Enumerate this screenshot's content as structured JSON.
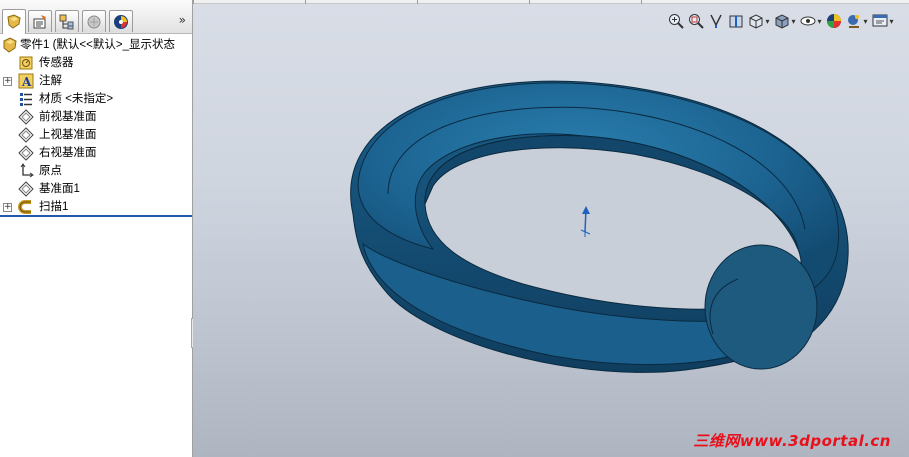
{
  "feature_tree": {
    "root_label": "零件1  (默认<<默认>_显示状态",
    "items": [
      {
        "label": "传感器"
      },
      {
        "label": "注解"
      },
      {
        "label": "材质 <未指定>"
      },
      {
        "label": "前视基准面"
      },
      {
        "label": "上视基准面"
      },
      {
        "label": "右视基准面"
      },
      {
        "label": "原点"
      },
      {
        "label": "基准面1"
      },
      {
        "label": "扫描1"
      }
    ],
    "more_label": "»"
  },
  "panel_tabs": [
    {
      "icon": "feature-manager-icon"
    },
    {
      "icon": "property-manager-icon"
    },
    {
      "icon": "configuration-manager-icon"
    },
    {
      "icon": "dimxpert-icon"
    },
    {
      "icon": "display-manager-icon"
    }
  ],
  "view_toolbar": [
    {
      "icon": "zoom-to-fit-icon"
    },
    {
      "icon": "zoom-to-area-icon"
    },
    {
      "icon": "previous-view-icon"
    },
    {
      "icon": "section-view-icon"
    },
    {
      "icon": "view-orientation-icon"
    },
    {
      "icon": "display-style-icon"
    },
    {
      "icon": "hide-show-items-icon"
    },
    {
      "icon": "edit-appearance-icon"
    },
    {
      "icon": "apply-scene-icon"
    },
    {
      "icon": "view-settings-icon"
    }
  ],
  "watermark": "三维网www.3dportal.cn",
  "colors": {
    "model_blue": "#1f5f8b",
    "rollback_bar": "#2458a8",
    "watermark": "#e8101a"
  }
}
